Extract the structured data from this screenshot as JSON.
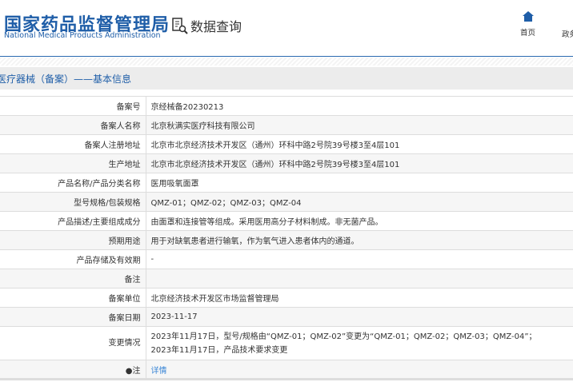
{
  "header": {
    "logo_cn": "国家药品监督管理局",
    "logo_en": "National Medical Products Administration",
    "section": "数据查询",
    "nav": [
      {
        "label": "首页",
        "icon": "home-icon"
      },
      {
        "label": "政务"
      }
    ]
  },
  "title": "医疗器械（备案）——基本信息",
  "rows": [
    {
      "label": "备案号",
      "value": "京经械备20230213"
    },
    {
      "label": "备案人名称",
      "value": "北京秋满实医疗科技有限公司"
    },
    {
      "label": "备案人注册地址",
      "value": "北京市北京经济技术开发区（通州）环科中路2号院39号楼3至4层101"
    },
    {
      "label": "生产地址",
      "value": "北京市北京经济技术开发区（通州）环科中路2号院39号楼3至4层101"
    },
    {
      "label": "产品名称/产品分类名称",
      "value": "医用吸氧面罩"
    },
    {
      "label": "型号规格/包装规格",
      "value": "QMZ-01；QMZ-02；QMZ-03；QMZ-04"
    },
    {
      "label": "产品描述/主要组成成分",
      "value": "由面罩和连接管等组成。采用医用高分子材料制成。非无菌产品。"
    },
    {
      "label": "预期用途",
      "value": "用于对缺氧患者进行输氧，作为氧气进入患者体内的通道。"
    },
    {
      "label": "产品存储及有效期",
      "value": "-"
    },
    {
      "label": "备注",
      "value": ""
    },
    {
      "label": "备案单位",
      "value": "北京经济技术开发区市场监督管理局"
    },
    {
      "label": "备案日期",
      "value": "2023-11-17"
    },
    {
      "label": "变更情况",
      "value_line1": "2023年11月17日，型号/规格由“QMZ-01；QMZ-02”变更为“QMZ-01；QMZ-02；QMZ-03；QMZ-04”；",
      "value_line2": "2023年11月17日，产品技术要求变更"
    },
    {
      "label": "注",
      "value": "详情",
      "icon": "pin-icon"
    }
  ]
}
